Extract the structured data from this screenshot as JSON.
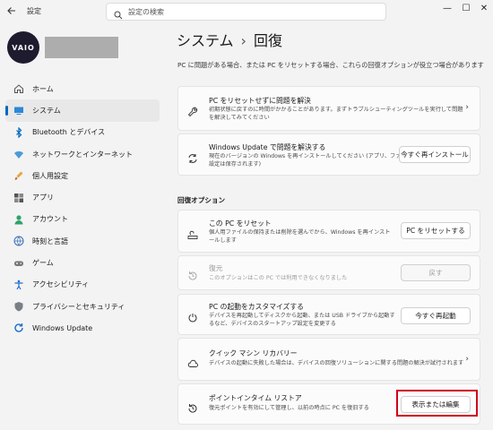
{
  "window": {
    "app_title": "設定",
    "controls": [
      "—",
      "☐",
      "✕"
    ]
  },
  "search": {
    "placeholder": "設定の検索"
  },
  "profile": {
    "logo_text": "VAIO"
  },
  "sidebar": {
    "items": [
      {
        "label": "ホーム",
        "icon": "home-icon",
        "active": false
      },
      {
        "label": "システム",
        "icon": "system-icon",
        "active": true
      },
      {
        "label": "Bluetooth とデバイス",
        "icon": "bluetooth-icon",
        "active": false
      },
      {
        "label": "ネットワークとインターネット",
        "icon": "wifi-icon",
        "active": false
      },
      {
        "label": "個人用設定",
        "icon": "paintbrush-icon",
        "active": false
      },
      {
        "label": "アプリ",
        "icon": "apps-icon",
        "active": false
      },
      {
        "label": "アカウント",
        "icon": "account-icon",
        "active": false
      },
      {
        "label": "時刻と言語",
        "icon": "globe-clock-icon",
        "active": false
      },
      {
        "label": "ゲーム",
        "icon": "gamepad-icon",
        "active": false
      },
      {
        "label": "アクセシビリティ",
        "icon": "accessibility-icon",
        "active": false
      },
      {
        "label": "プライバシーとセキュリティ",
        "icon": "shield-icon",
        "active": false
      },
      {
        "label": "Windows Update",
        "icon": "windows-update-icon",
        "active": false
      }
    ]
  },
  "header": {
    "parent": "システム",
    "separator": "›",
    "current": "回復",
    "description": "PC に問題がある場合、または PC をリセットする場合、これらの回復オプションが役立つ場合があります"
  },
  "cards_top": [
    {
      "title": "PC をリセットせずに問題を解決",
      "desc_line1": "初期状態に戻すのに時間がかかることがあります。まずトラブルシューティングツールを実行して問題",
      "desc_line2": "を解決してみてください",
      "chevron": "›"
    },
    {
      "title": "Windows Update で問題を解決する",
      "desc_line1": "現在のバージョンの Windows を再インストールしてください (アプリ、ファイル、",
      "desc_line2": "設定は保存されます)",
      "button": "今すぐ再インストール"
    }
  ],
  "recovery_options": {
    "heading": "回復オプション",
    "items": [
      {
        "title": "この PC をリセット",
        "desc_line1": "個人用ファイルの保持または削除を選んでから、Windows を再インスト",
        "desc_line2": "ールします",
        "button": "PC をリセットする"
      },
      {
        "title": "復元",
        "desc_line1": "このオプションはこの PC では利用できなくなりました",
        "button": "戻す",
        "disabled": true
      },
      {
        "title": "PC の起動をカスタマイズする",
        "desc_line1": "デバイスを再起動してディスクから起動、または USB ドライブから起動す",
        "desc_line2": "るなど、デバイスのスタートアップ設定を変更する",
        "button": "今すぐ再起動"
      },
      {
        "title": "クイック マシン リカバリー",
        "desc_line1": "デバイスの起動に失敗した場合は、デバイスの回復ソリューションに関する問題の解決が試行されます",
        "chevron": "›"
      },
      {
        "title": "ポイントインタイム リストア",
        "desc_line1": "復元ポイントを有効にして管理し、以前の時点に PC を復旧する",
        "button": "表示または編集"
      }
    ]
  },
  "colors": {
    "accent": "#0067c0",
    "highlight": "#d0021b"
  }
}
